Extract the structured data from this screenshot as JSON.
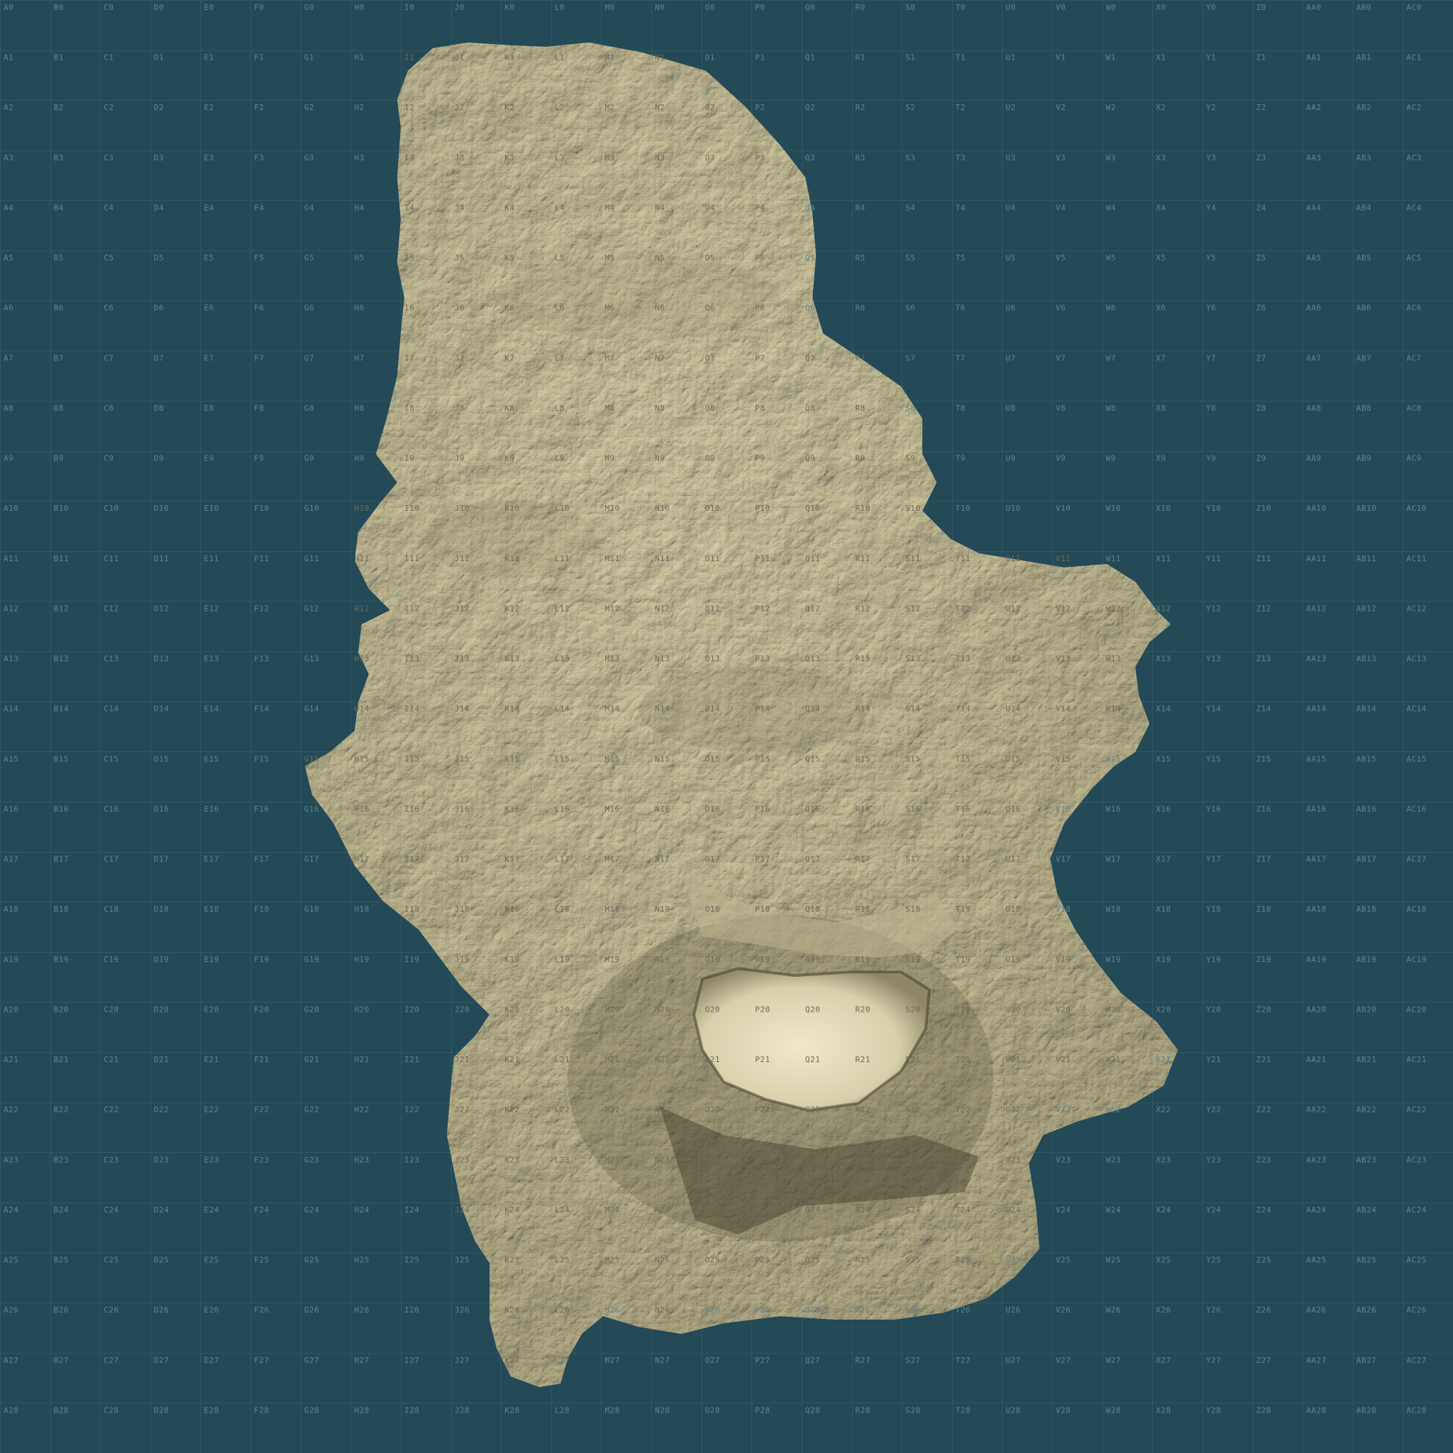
{
  "map": {
    "grid": {
      "columns": [
        "A",
        "B",
        "C",
        "D",
        "E",
        "F",
        "G",
        "H",
        "I",
        "J",
        "K",
        "L",
        "M",
        "N",
        "O",
        "P",
        "Q",
        "R",
        "S",
        "T",
        "U",
        "V",
        "W",
        "X",
        "Y",
        "Z",
        "AA",
        "AB",
        "AC"
      ],
      "rows": [
        0,
        1,
        2,
        3,
        4,
        5,
        6,
        7,
        8,
        9,
        10,
        11,
        12,
        13,
        14,
        15,
        16,
        17,
        18,
        19,
        20,
        21,
        22,
        23,
        24,
        25,
        26,
        27,
        28
      ]
    },
    "colors": {
      "sea": "#234a56",
      "grid_line": "#3e6470",
      "land_base": "#c2bb96",
      "land_highlight": "#e7e1c0",
      "land_shadow": "#4e4a35",
      "sea_label": "#5f8490",
      "land_label": "#6e6a58"
    },
    "features": {
      "island": "terrain-island",
      "crater": "volcanic-crater"
    }
  }
}
